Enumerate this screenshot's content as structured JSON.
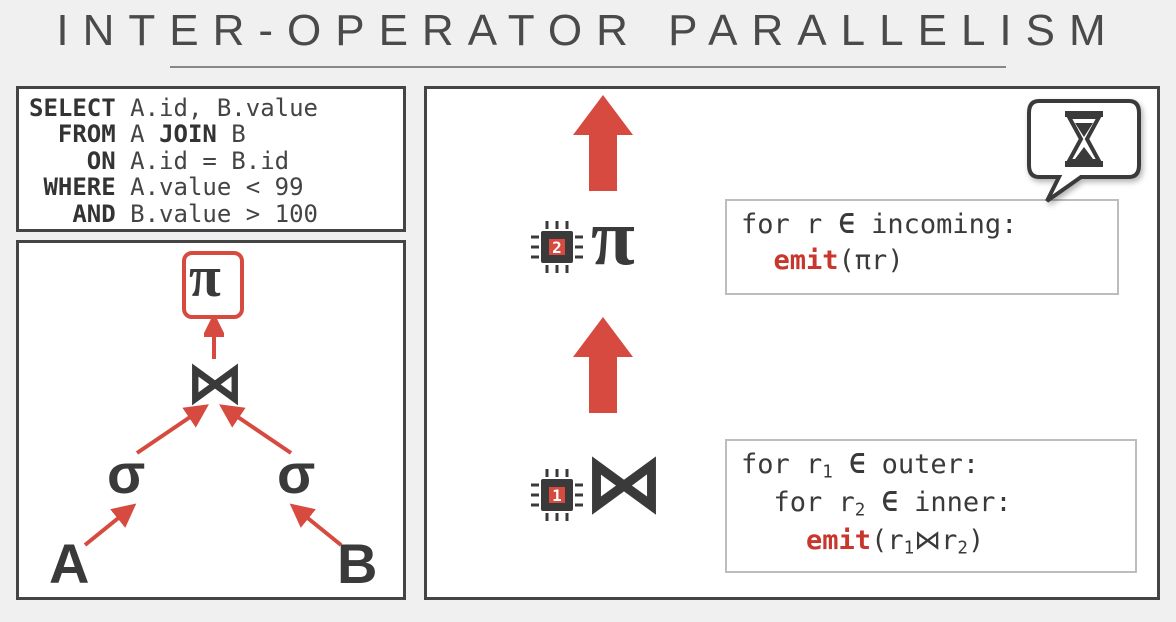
{
  "title": "INTER-OPERATOR PARALLELISM",
  "sql": {
    "l1a": "SELECT",
    "l1b": " A.id, B.value",
    "l2a": "  FROM",
    "l2b": " A ",
    "l2c": "JOIN",
    "l2d": " B",
    "l3a": "    ON",
    "l3b": " A.id = B.id",
    "l4a": " WHERE",
    "l4b": " A.value < 99",
    "l5a": "   AND",
    "l5b": " B.value > 100"
  },
  "plan": {
    "pi": "π",
    "join": "⋈",
    "sigma_left": "σ",
    "sigma_right": "σ",
    "rel_a": "A",
    "rel_b": "B"
  },
  "exec": {
    "op_top_sym": "π",
    "op_bottom_sym": "⋈",
    "cpu_top": "2",
    "cpu_bottom": "1",
    "code_top_line1a": "for r ",
    "code_top_line1b": "∈",
    "code_top_line1c": " incoming:",
    "code_top_emit": "emit",
    "code_top_line2": "(πr)",
    "code_bot_l1a": "for r",
    "code_bot_l1sub": "1",
    "code_bot_l1b": " ",
    "code_bot_l1in": "∈",
    "code_bot_l1c": " outer:",
    "code_bot_l2a": "  for r",
    "code_bot_l2sub": "2",
    "code_bot_l2b": " ",
    "code_bot_l2in": "∈",
    "code_bot_l2c": " inner:",
    "code_bot_emit": "emit",
    "code_bot_l3a": "(r",
    "code_bot_l3s1": "1",
    "code_bot_l3join": "⋈",
    "code_bot_l3b": "r",
    "code_bot_l3s2": "2",
    "code_bot_l3c": ")"
  }
}
